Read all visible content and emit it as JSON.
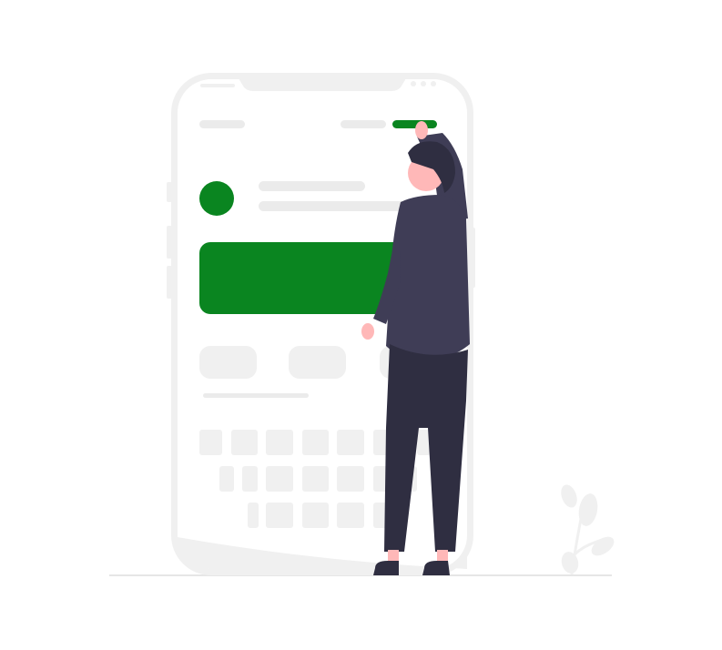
{
  "illustration": {
    "accent_color": "#0a8520",
    "phone_frame_color": "#f0f0f0",
    "placeholder_color": "#ebebeb",
    "person": {
      "shirt_color": "#3f3d56",
      "pants_color": "#2f2e41",
      "skin_color": "#ffb8b8",
      "hair_color": "#2f2e41"
    },
    "plant_color": "#f0f0f0",
    "ground_color": "#e6e6e6",
    "icons": [
      "smartphone-icon",
      "person-icon",
      "plant-icon"
    ]
  }
}
